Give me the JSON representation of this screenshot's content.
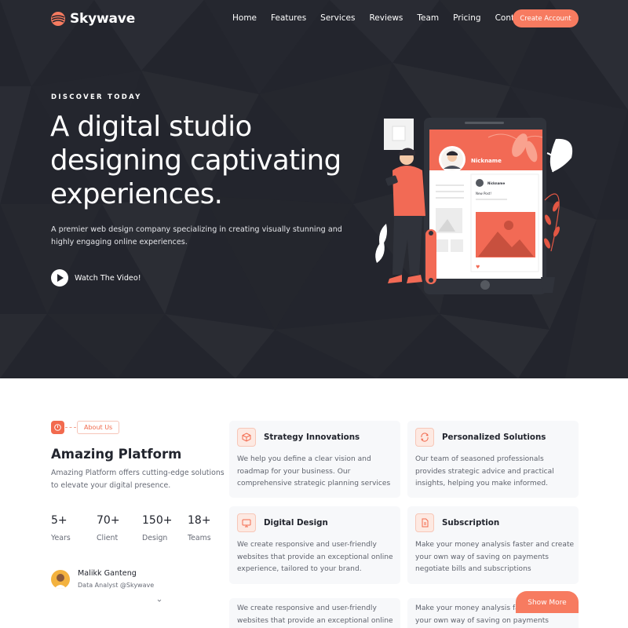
{
  "brand": {
    "name": "Skywave",
    "accent": "#f77b60",
    "dark": "#23252d"
  },
  "nav": {
    "items": [
      "Home",
      "Features",
      "Services",
      "Reviews",
      "Team",
      "Pricing",
      "Contact"
    ],
    "cta": "Create Account"
  },
  "hero": {
    "eyebrow": "DISCOVER TODAY",
    "title": "A digital studio designing captivating experiences.",
    "description": "A premier web design company specializing in creating visually stunning and highly engaging online experiences.",
    "video_label": "Watch The Video!",
    "illustration": {
      "profile_label": "Nickname",
      "post_label": "Nickname",
      "post_text": "New Post!"
    }
  },
  "about": {
    "badge": "About Us",
    "title": "Amazing Platform",
    "description": "Amazing Platform offers cutting-edge solutions to elevate your digital presence.",
    "stats": [
      {
        "value": "5+",
        "label": "Years"
      },
      {
        "value": "70+",
        "label": "Client"
      },
      {
        "value": "150+",
        "label": "Design"
      },
      {
        "value": "18+",
        "label": "Teams"
      }
    ],
    "person": {
      "name": "Malikk Ganteng",
      "role": "Data Analyst @Skywave"
    }
  },
  "services": [
    {
      "icon": "cube-icon",
      "title": "Strategy Innovations",
      "text": "We help you define a clear vision and roadmap for your business. Our comprehensive strategic planning services"
    },
    {
      "icon": "refresh-icon",
      "title": "Personalized Solutions",
      "text": "Our team of seasoned professionals provides strategic advice and practical insights, helping you make informed."
    },
    {
      "icon": "monitor-icon",
      "title": "Digital Design",
      "text": "We create responsive and user-friendly websites that provide an exceptional online experience, tailored to your brand."
    },
    {
      "icon": "document-icon",
      "title": "Subscription",
      "text": "Make your money analysis faster and create your own way of saving on payments negotiate bills and subscriptions"
    }
  ],
  "services_partial": [
    {
      "text": "We create responsive and user-friendly websites that provide an exceptional online"
    },
    {
      "text": "Make your money analysis faster and create your own way of saving on payments"
    }
  ],
  "show_more": "Show More"
}
